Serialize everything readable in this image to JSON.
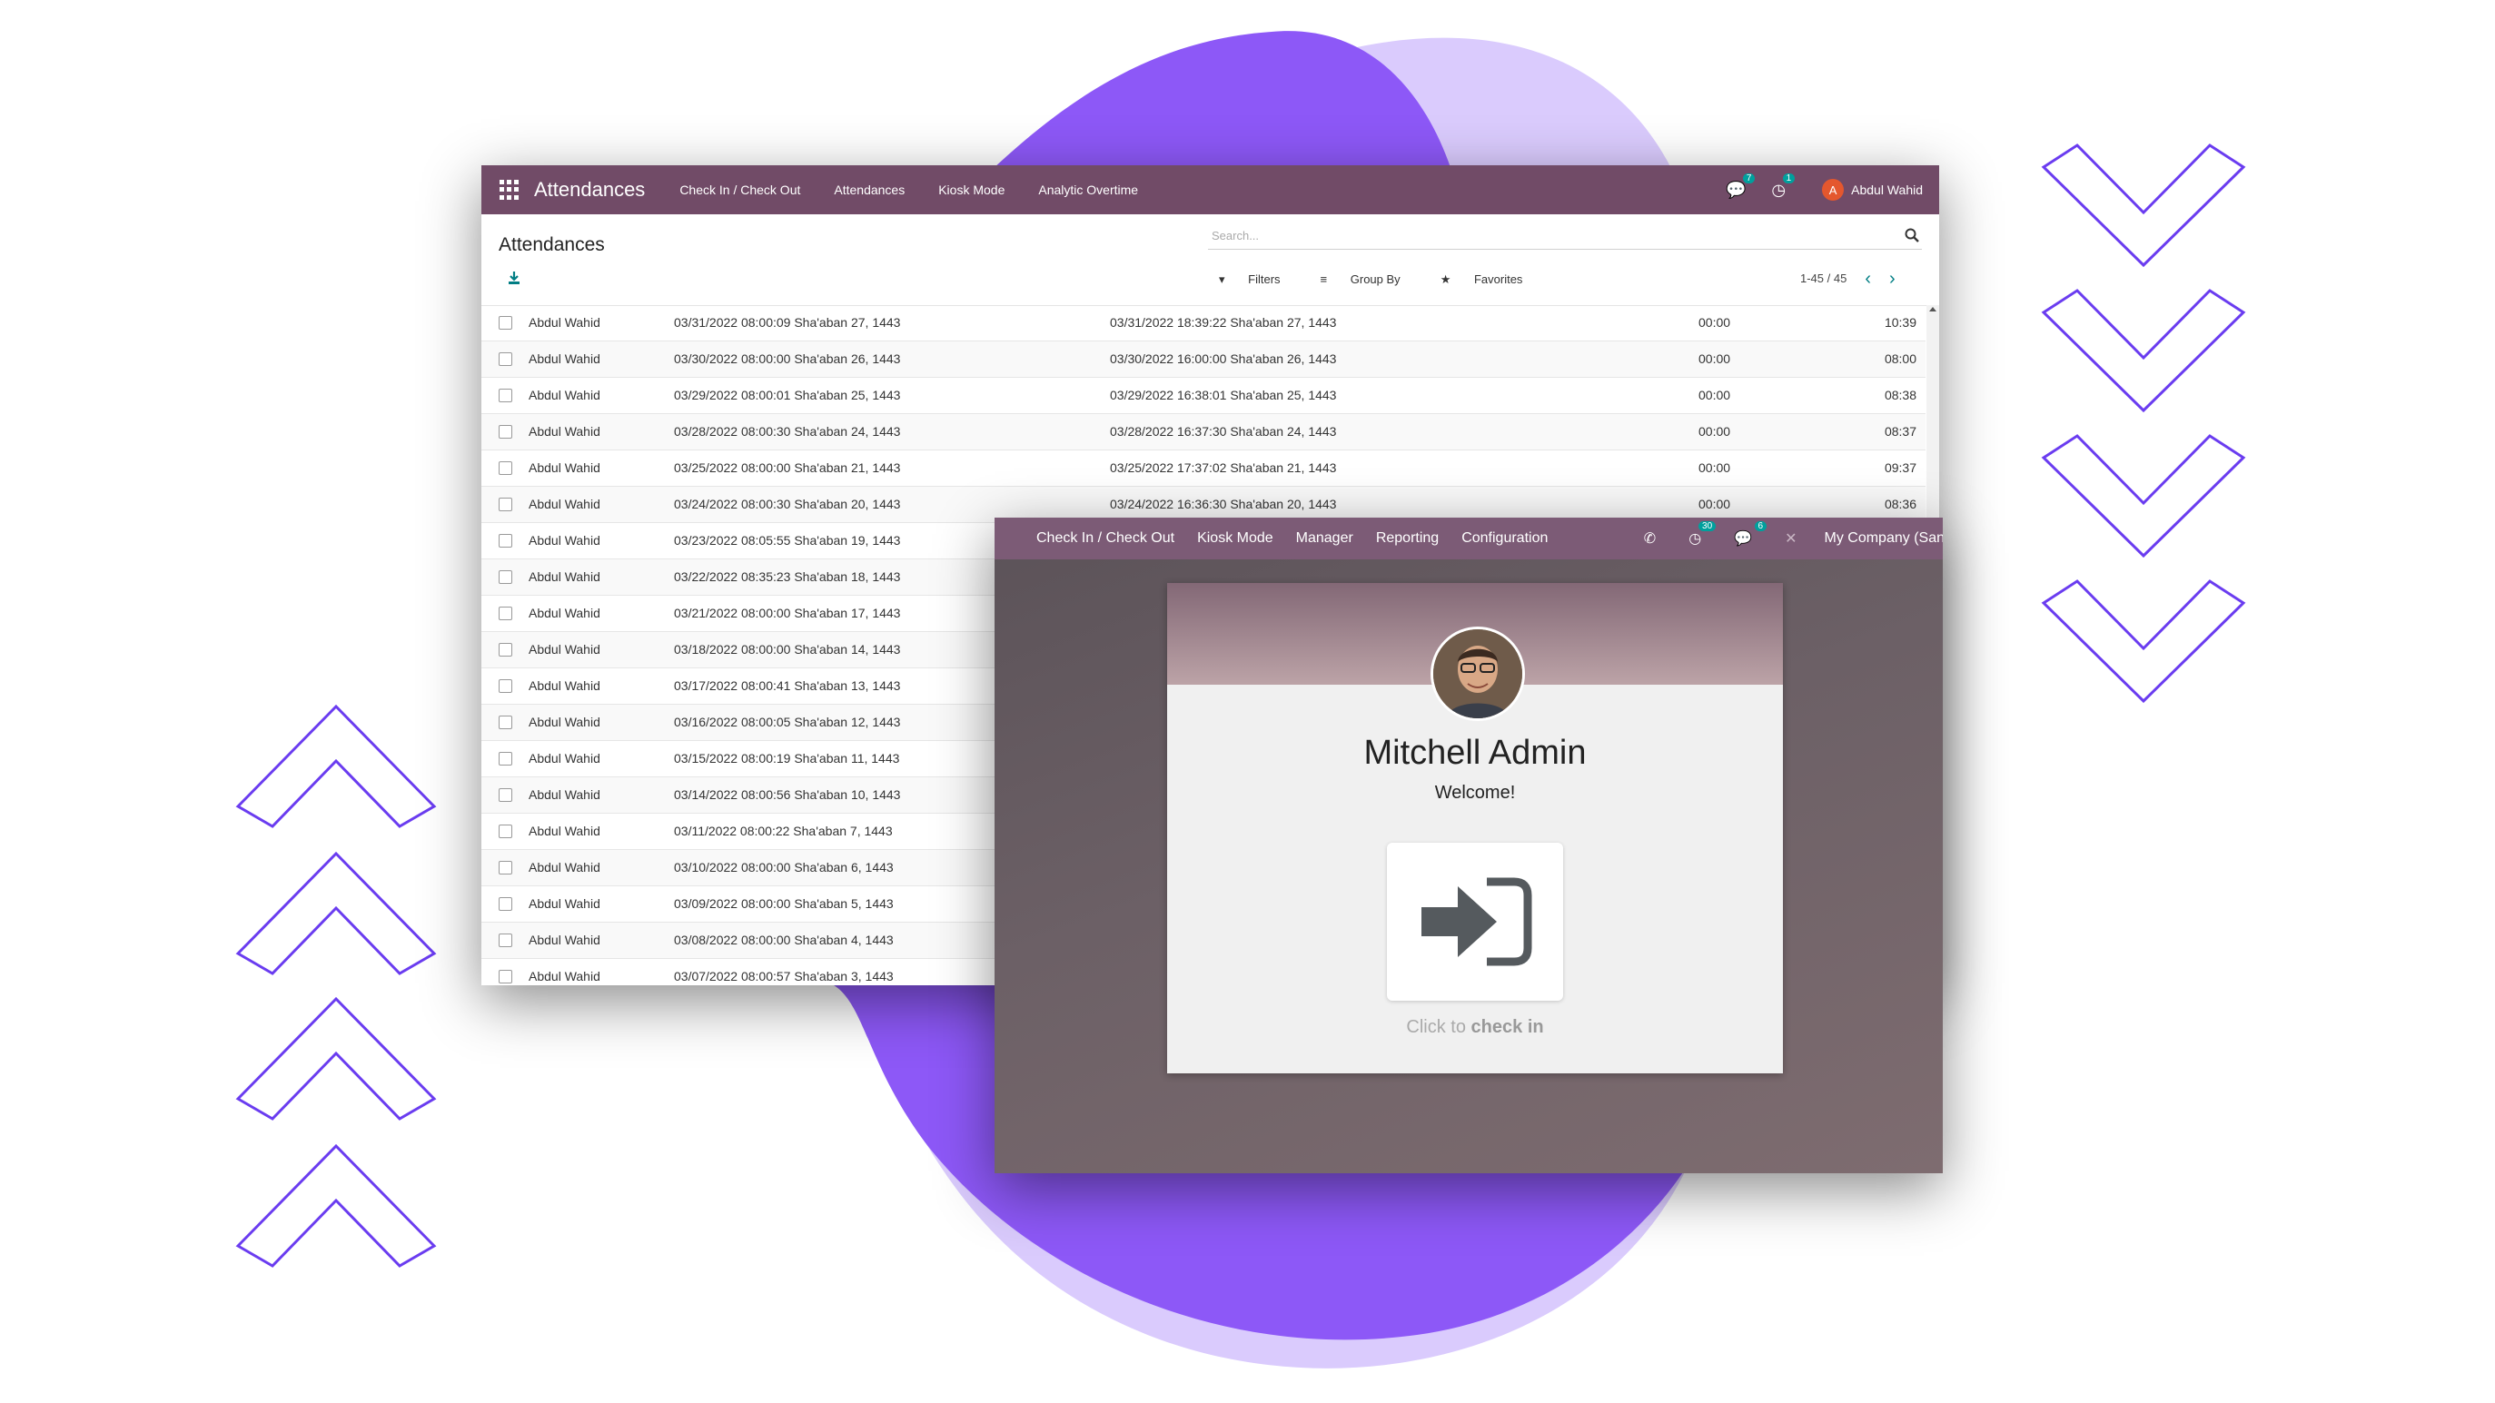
{
  "colors": {
    "odoo_purple": "#714b67",
    "kiosk_purple": "#7c5b76",
    "blob_dark": "#8b58f6",
    "blob_light": "#d9c9fc",
    "chevron": "#6a3cf0",
    "teal": "#00a09d"
  },
  "list_window": {
    "app_name": "Attendances",
    "menu": [
      "Check In / Check Out",
      "Attendances",
      "Kiosk Mode",
      "Analytic Overtime"
    ],
    "messages_count": "7",
    "activities_count": "1",
    "user_initial": "A",
    "user_name": "Abdul Wahid",
    "breadcrumb_title": "Attendances",
    "search_placeholder": "Search...",
    "filters_label": "Filters",
    "group_by_label": "Group By",
    "favorites_label": "Favorites",
    "pager": "1-45 / 45",
    "rows": [
      {
        "employee": "Abdul Wahid",
        "check_in": "03/31/2022 08:00:09 Sha'aban 27, 1443",
        "check_out": "03/31/2022 18:39:22 Sha'aban 27, 1443",
        "overtime": "00:00",
        "worked": "10:39"
      },
      {
        "employee": "Abdul Wahid",
        "check_in": "03/30/2022 08:00:00 Sha'aban 26, 1443",
        "check_out": "03/30/2022 16:00:00 Sha'aban 26, 1443",
        "overtime": "00:00",
        "worked": "08:00"
      },
      {
        "employee": "Abdul Wahid",
        "check_in": "03/29/2022 08:00:01 Sha'aban 25, 1443",
        "check_out": "03/29/2022 16:38:01 Sha'aban 25, 1443",
        "overtime": "00:00",
        "worked": "08:38"
      },
      {
        "employee": "Abdul Wahid",
        "check_in": "03/28/2022 08:00:30 Sha'aban 24, 1443",
        "check_out": "03/28/2022 16:37:30 Sha'aban 24, 1443",
        "overtime": "00:00",
        "worked": "08:37"
      },
      {
        "employee": "Abdul Wahid",
        "check_in": "03/25/2022 08:00:00 Sha'aban 21, 1443",
        "check_out": "03/25/2022 17:37:02 Sha'aban 21, 1443",
        "overtime": "00:00",
        "worked": "09:37"
      },
      {
        "employee": "Abdul Wahid",
        "check_in": "03/24/2022 08:00:30 Sha'aban 20, 1443",
        "check_out": "03/24/2022 16:36:30 Sha'aban 20, 1443",
        "overtime": "00:00",
        "worked": "08:36"
      },
      {
        "employee": "Abdul Wahid",
        "check_in": "03/23/2022 08:05:55 Sha'aban 19, 1443",
        "check_out": "",
        "overtime": "",
        "worked": ""
      },
      {
        "employee": "Abdul Wahid",
        "check_in": "03/22/2022 08:35:23 Sha'aban 18, 1443",
        "check_out": "",
        "overtime": "",
        "worked": ""
      },
      {
        "employee": "Abdul Wahid",
        "check_in": "03/21/2022 08:00:00 Sha'aban 17, 1443",
        "check_out": "",
        "overtime": "",
        "worked": ""
      },
      {
        "employee": "Abdul Wahid",
        "check_in": "03/18/2022 08:00:00 Sha'aban 14, 1443",
        "check_out": "",
        "overtime": "",
        "worked": ""
      },
      {
        "employee": "Abdul Wahid",
        "check_in": "03/17/2022 08:00:41 Sha'aban 13, 1443",
        "check_out": "",
        "overtime": "",
        "worked": ""
      },
      {
        "employee": "Abdul Wahid",
        "check_in": "03/16/2022 08:00:05 Sha'aban 12, 1443",
        "check_out": "",
        "overtime": "",
        "worked": ""
      },
      {
        "employee": "Abdul Wahid",
        "check_in": "03/15/2022 08:00:19 Sha'aban 11, 1443",
        "check_out": "",
        "overtime": "",
        "worked": ""
      },
      {
        "employee": "Abdul Wahid",
        "check_in": "03/14/2022 08:00:56 Sha'aban 10, 1443",
        "check_out": "",
        "overtime": "",
        "worked": ""
      },
      {
        "employee": "Abdul Wahid",
        "check_in": "03/11/2022 08:00:22 Sha'aban 7, 1443",
        "check_out": "",
        "overtime": "",
        "worked": ""
      },
      {
        "employee": "Abdul Wahid",
        "check_in": "03/10/2022 08:00:00 Sha'aban 6, 1443",
        "check_out": "",
        "overtime": "",
        "worked": ""
      },
      {
        "employee": "Abdul Wahid",
        "check_in": "03/09/2022 08:00:00 Sha'aban 5, 1443",
        "check_out": "",
        "overtime": "",
        "worked": ""
      },
      {
        "employee": "Abdul Wahid",
        "check_in": "03/08/2022 08:00:00 Sha'aban 4, 1443",
        "check_out": "",
        "overtime": "",
        "worked": ""
      },
      {
        "employee": "Abdul Wahid",
        "check_in": "03/07/2022 08:00:57 Sha'aban 3, 1443",
        "check_out": "",
        "overtime": "",
        "worked": ""
      }
    ]
  },
  "kiosk_window": {
    "menu": [
      "Check In / Check Out",
      "Kiosk Mode",
      "Manager",
      "Reporting",
      "Configuration"
    ],
    "activities_count": "30",
    "messages_count": "6",
    "company": "My Company (San",
    "employee_name": "Mitchell Admin",
    "welcome": "Welcome!",
    "click_to": "Click to",
    "check_in": "check in"
  }
}
